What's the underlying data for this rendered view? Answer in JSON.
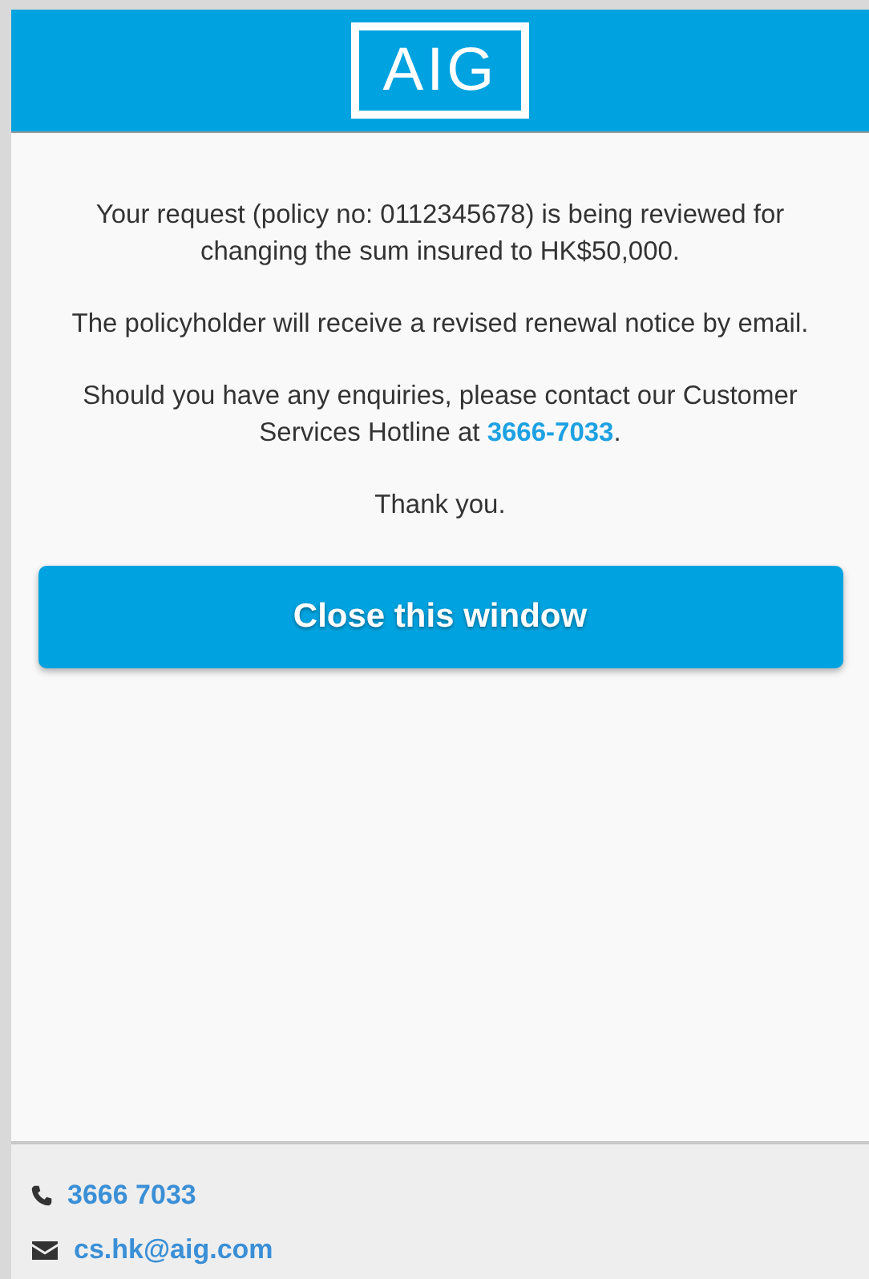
{
  "header": {
    "logo": "AIG"
  },
  "message": {
    "paragraphs": [
      {
        "kind": "text",
        "text": "Your request (policy no: 0112345678) is being reviewed for changing the sum insured to HK$50,000."
      },
      {
        "kind": "text",
        "text": "The policyholder will receive a revised renewal notice by email."
      },
      {
        "kind": "link",
        "text": "Should you have any enquiries, please contact our Customer Services Hotline at ",
        "link": "3666-7033",
        "after": "."
      },
      {
        "kind": "text",
        "text": "Thank you."
      }
    ]
  },
  "close_button": "Close this window",
  "footer": {
    "contacts": [
      {
        "kind": "phone",
        "text": "3666 7033"
      },
      {
        "kind": "email",
        "text": "cs.hk@aig.com"
      }
    ]
  }
}
